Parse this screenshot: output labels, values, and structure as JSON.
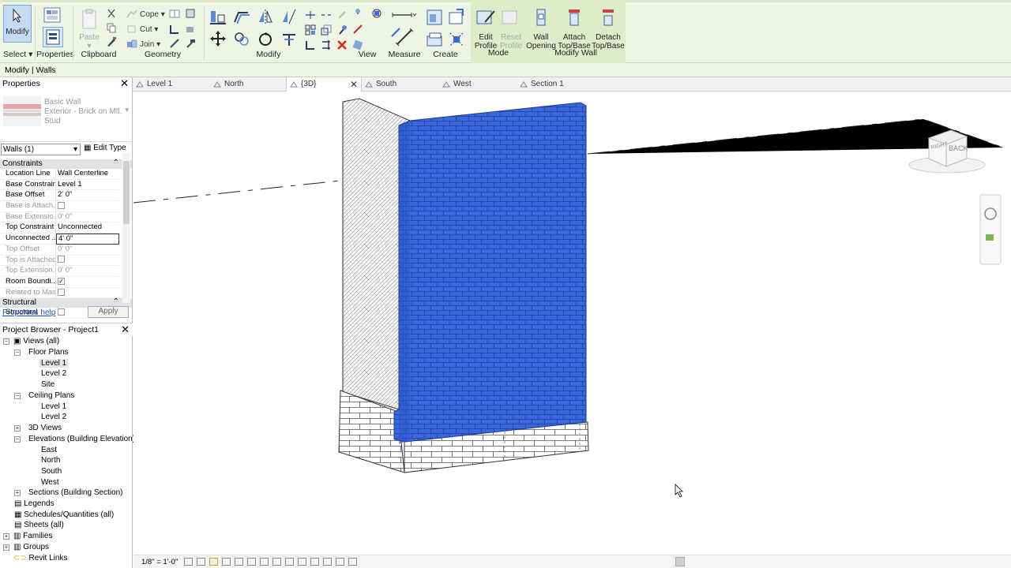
{
  "ribbon": {
    "groups": {
      "select": "Select",
      "properties": "Properties",
      "clipboard": "Clipboard",
      "geometry": "Geometry",
      "modify": "Modify",
      "view": "View",
      "measure": "Measure",
      "create": "Create",
      "mode": "Mode",
      "modify_wall": "Modify Wall"
    },
    "buttons": {
      "modify": "Modify",
      "paste": "Paste",
      "cope": "Cope",
      "cut": "Cut",
      "join": "Join",
      "edit_profile_1": "Edit",
      "edit_profile_2": "Profile",
      "reset_profile_1": "Reset",
      "reset_profile_2": "Profile",
      "wall_opening_1": "Wall",
      "wall_opening_2": "Opening",
      "attach_1": "Attach",
      "attach_2": "Top/Base",
      "detach_1": "Detach",
      "detach_2": "Top/Base"
    }
  },
  "options_bar": {
    "context": "Modify | Walls"
  },
  "properties": {
    "title": "Properties",
    "type_family": "Basic Wall",
    "type_name_1": "Exterior - Brick on Mtl.",
    "type_name_2": "Stud",
    "instance_selector": "Walls (1)",
    "edit_type": "Edit Type",
    "categories": {
      "constraints": "Constraints",
      "structural": "Structural"
    },
    "rows": [
      {
        "name": "Location Line",
        "value": "Wall Centerline"
      },
      {
        "name": "Base Constraint",
        "value": "Level 1"
      },
      {
        "name": "Base Offset",
        "value": "2'  0\""
      },
      {
        "name": "Base is Attach...",
        "value": ""
      },
      {
        "name": "Base Extensio...",
        "value": "0'  0\""
      },
      {
        "name": "Top Constraint",
        "value": "Unconnected"
      },
      {
        "name": "Unconnected ...",
        "value": "4'  0\""
      },
      {
        "name": "Top Offset",
        "value": "0'  0\""
      },
      {
        "name": "Top is Attached",
        "value": ""
      },
      {
        "name": "Top Extension...",
        "value": "0'  0\""
      },
      {
        "name": "Room Boundi...",
        "value": ""
      },
      {
        "name": "Related to Mass",
        "value": ""
      },
      {
        "name": "Structural",
        "value": ""
      }
    ],
    "help_link": "Properties help",
    "apply": "Apply"
  },
  "project_browser": {
    "title": "Project Browser - Project1",
    "nodes": {
      "views_all": "Views (all)",
      "floor_plans": "Floor Plans",
      "fp_level1": "Level 1",
      "fp_level2": "Level 2",
      "fp_site": "Site",
      "ceiling_plans": "Ceiling Plans",
      "cp_level1": "Level 1",
      "cp_level2": "Level 2",
      "views_3d": "3D Views",
      "elevations": "Elevations (Building Elevation)",
      "el_east": "East",
      "el_north": "North",
      "el_south": "South",
      "el_west": "West",
      "sections": "Sections (Building Section)",
      "legends": "Legends",
      "schedules": "Schedules/Quantities (all)",
      "sheets": "Sheets (all)",
      "families": "Families",
      "groups": "Groups",
      "revit_links": "Revit Links"
    }
  },
  "tabs": [
    "Level 1",
    "North",
    "{3D}",
    "South",
    "West",
    "Section 1"
  ],
  "viewcube": {
    "left_face": "RIGHT",
    "right_face": "BACK"
  },
  "view_bar": {
    "scale": "1/8\" = 1'-0\""
  },
  "colors": {
    "wall_highlight": "#3a68dc",
    "ribbon_bg": "#eef5e4",
    "link": "#1a57b5"
  }
}
